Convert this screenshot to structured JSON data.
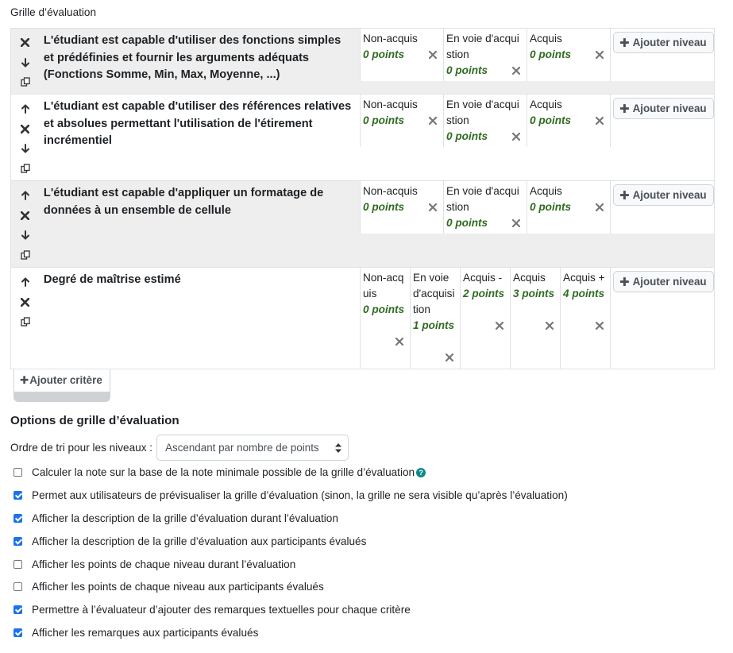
{
  "section_label": "Grille d’évaluation",
  "add_level_label": "Ajouter niveau",
  "add_criterion_label": "Ajouter critère",
  "criteria": [
    {
      "description": "L'étudiant est capable d'utiliser des fonctions simples et prédéfinies et fournir les arguments adéquats (Fonctions Somme, Min, Max, Moyenne, ...)",
      "levels": [
        {
          "definition": "Non-acquis",
          "points": "0 points"
        },
        {
          "definition": "En voie d'acquistion",
          "points": "0 points"
        },
        {
          "definition": "Acquis",
          "points": "0 points"
        }
      ]
    },
    {
      "description": "L'étudiant est capable d'utiliser des références relatives et absolues permettant l'utilisation de l'étirement incrémentiel",
      "levels": [
        {
          "definition": "Non-acquis",
          "points": "0 points"
        },
        {
          "definition": "En voie d'acquistion",
          "points": "0 points"
        },
        {
          "definition": "Acquis",
          "points": "0 points"
        }
      ]
    },
    {
      "description": "L'étudiant est capable d'appliquer un formatage de données à un ensemble de cellule",
      "levels": [
        {
          "definition": "Non-acquis",
          "points": "0 points"
        },
        {
          "definition": "En voie d'acquistion",
          "points": "0 points"
        },
        {
          "definition": "Acquis",
          "points": "0 points"
        }
      ]
    },
    {
      "description": "Degré de maîtrise estimé",
      "levels": [
        {
          "definition": "Non-acquis",
          "points": "0 points"
        },
        {
          "definition": "En voie d'acquisition",
          "points": "1 points"
        },
        {
          "definition": "Acquis -",
          "points": "2 points"
        },
        {
          "definition": "Acquis",
          "points": "3 points"
        },
        {
          "definition": "Acquis +",
          "points": "4 points"
        }
      ]
    }
  ],
  "options": {
    "title": "Options de grille d’évaluation",
    "sort_label": "Ordre de tri pour les niveaux :",
    "sort_value": "Ascendant par nombre de points",
    "checkboxes": [
      {
        "label": "Calculer la note sur la base de la note minimale possible de la grille d’évaluation",
        "checked": false,
        "help": true
      },
      {
        "label": "Permet aux utilisateurs de prévisualiser la grille d’évaluation (sinon, la grille ne sera visible qu’après l’évaluation)",
        "checked": true
      },
      {
        "label": "Afficher la description de la grille d’évaluation durant l’évaluation",
        "checked": true
      },
      {
        "label": "Afficher la description de la grille d’évaluation aux participants évalués",
        "checked": true
      },
      {
        "label": "Afficher les points de chaque niveau durant l’évaluation",
        "checked": false
      },
      {
        "label": "Afficher les points de chaque niveau aux participants évalués",
        "checked": false
      },
      {
        "label": "Permettre à l’évaluateur d’ajouter des remarques textuelles pour chaque critère",
        "checked": true
      },
      {
        "label": "Afficher les remarques aux participants évalués",
        "checked": true
      }
    ]
  },
  "colors": {
    "points_green": "#2f6b20",
    "row_grey": "#eeeeee",
    "checkbox_blue": "#1a73e8",
    "help_teal": "#0f8a8a"
  }
}
